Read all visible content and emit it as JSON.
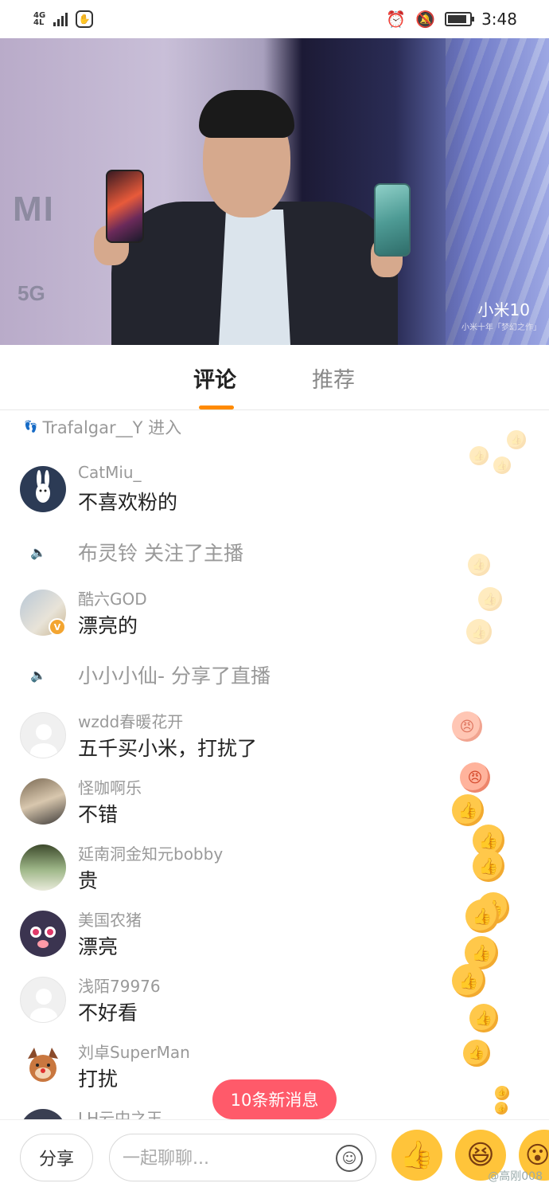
{
  "status_bar": {
    "network": "4G",
    "network_sub": "4L",
    "time": "3:48",
    "alarm_icon": "alarm-icon",
    "mute_icon": "bell-off-icon",
    "battery_level": 0.9
  },
  "video": {
    "brand_text": "MI",
    "network_text": "5G",
    "product_label": "小米10",
    "product_sub": "小米十年「梦幻之作」"
  },
  "tabs": [
    {
      "label": "评论",
      "active": true
    },
    {
      "label": "推荐",
      "active": false
    }
  ],
  "feed": {
    "enter_notice": "Trafalgar__Y 进入",
    "items": [
      {
        "type": "comment",
        "name": "CatMiu_",
        "text": "不喜欢粉的"
      },
      {
        "type": "system",
        "text": "布灵铃 关注了主播"
      },
      {
        "type": "comment",
        "name": "酷六GOD",
        "text": "漂亮的",
        "verified": true
      },
      {
        "type": "system",
        "text": "小小小仙- 分享了直播"
      },
      {
        "type": "comment",
        "name": "wzdd春暖花开",
        "text": "五千买小米，打扰了"
      },
      {
        "type": "comment",
        "name": "怪咖啊乐",
        "text": "不错"
      },
      {
        "type": "comment",
        "name": "延南洞金知元bobby",
        "text": "贵"
      },
      {
        "type": "comment",
        "name": "美国农猪",
        "text": "漂亮"
      },
      {
        "type": "comment",
        "name": "浅陌79976",
        "text": "不好看"
      },
      {
        "type": "comment",
        "name": "刘卓SuperMan",
        "text": "打扰"
      },
      {
        "type": "comment",
        "name": "LH云中之王",
        "text": ""
      }
    ]
  },
  "new_messages": "10条新消息",
  "bottom": {
    "share_label": "分享",
    "chat_placeholder": "一起聊聊...",
    "watermark": "@高刚008"
  },
  "colors": {
    "accent": "#ff8a00",
    "pill": "#ff5a6a",
    "reaction": "#ffc43a"
  }
}
